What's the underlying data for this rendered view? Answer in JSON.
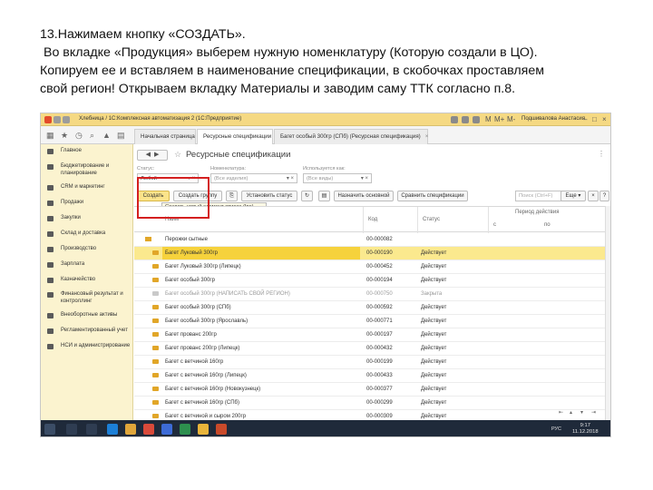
{
  "instructions": {
    "line1": "13.Нажимаем кнопку «СОЗДАТЬ».",
    "line2": "Во вкладке «Продукция» выберем нужную номенклатуру (Которую создали в ЦО).",
    "line3": "Копируем ее и вставляем в наименование спецификации, в скобочках проставляем",
    "line4": "свой регион! Открываем вкладку Материалы и заводим саму ТТК  согласно п.8."
  },
  "window": {
    "title": "Хлебница / 1С:Комплексная автоматизация 2 (1С:Предприятие)",
    "user": "Подшивалова Анастасия"
  },
  "page_tabs": [
    {
      "label": "Начальная страница"
    },
    {
      "label": "Ресурсные спецификации"
    },
    {
      "label": "Багет особый 300гр (СПб) (Ресурсная спецификация)"
    }
  ],
  "sidebar": {
    "items": [
      {
        "label": "Главное",
        "icon": "menu-icon"
      },
      {
        "label": "Бюджетирование и планирование",
        "icon": "chart-icon"
      },
      {
        "label": "CRM и маркетинг",
        "icon": "crm-icon"
      },
      {
        "label": "Продажи",
        "icon": "cart-icon"
      },
      {
        "label": "Закупки",
        "icon": "truck-icon"
      },
      {
        "label": "Склад и доставка",
        "icon": "warehouse-icon"
      },
      {
        "label": "Производство",
        "icon": "factory-icon"
      },
      {
        "label": "Зарплата",
        "icon": "salary-icon"
      },
      {
        "label": "Казначейство",
        "icon": "treasury-icon"
      },
      {
        "label": "Финансовый результат и контроллинг",
        "icon": "finance-icon"
      },
      {
        "label": "Внеоборотные активы",
        "icon": "assets-icon"
      },
      {
        "label": "Регламентированный учет",
        "icon": "ledger-icon"
      },
      {
        "label": "НСИ и администрирование",
        "icon": "settings-icon"
      }
    ]
  },
  "page": {
    "title": "Ресурсные спецификации"
  },
  "filters": {
    "status_label": "Статус:",
    "status_value": "Любой",
    "nomenclature_label": "Номенклатура:",
    "nomenclature_placeholder": "(Все изделия)",
    "used_as_label": "Используется как:",
    "used_as_placeholder": "(Все виды)"
  },
  "toolbar": {
    "create": "Создать",
    "create_group": "Создать группу",
    "set_status": "Установить статус",
    "set_main": "Назначить основной",
    "compare": "Сравнить спецификации",
    "search_placeholder": "Поиск (Ctrl+F)",
    "more": "Еще",
    "help": "?"
  },
  "tooltip": "Создать новый элемент списка (Ins)",
  "table": {
    "headers": {
      "name": "Наим",
      "code": "Код",
      "status": "Статус",
      "period": "Период действия",
      "from": "с",
      "to": "по"
    },
    "group_row": {
      "name": "Перожки сытные",
      "code": "00-000082"
    },
    "rows": [
      {
        "name": "Багет Луковый 300гр",
        "code": "00-000190",
        "status": "Действует"
      },
      {
        "name": "Багет Луковый 300гр (Липецк)",
        "code": "00-000452",
        "status": "Действует"
      },
      {
        "name": "Багет особый 300гр",
        "code": "00-000194",
        "status": "Действует"
      },
      {
        "name": "Багет особый 300гр (НАПИСАТЬ СВОЙ РЕГИОН)",
        "code": "00-000750",
        "status": "Закрыта"
      },
      {
        "name": "Багет особый 300гр (СПб)",
        "code": "00-000592",
        "status": "Действует"
      },
      {
        "name": "Багет особый 300гр (Ярославль)",
        "code": "00-000771",
        "status": "Действует"
      },
      {
        "name": "Багет прованс 200гр",
        "code": "00-000197",
        "status": "Действует"
      },
      {
        "name": "Багет прованс 200гр (Липецк)",
        "code": "00-000432",
        "status": "Действует"
      },
      {
        "name": "Багет с ветчиной 160гр",
        "code": "00-000199",
        "status": "Действует"
      },
      {
        "name": "Багет с ветчиной 160гр (Липецк)",
        "code": "00-000433",
        "status": "Действует"
      },
      {
        "name": "Багет с ветчиной 160гр (Новокузнецк)",
        "code": "00-000377",
        "status": "Действует"
      },
      {
        "name": "Багет с ветчиной 160гр (СПб)",
        "code": "00-000299",
        "status": "Действует"
      },
      {
        "name": "Багет с ветчиной и сыром 200гр",
        "code": "00-000309",
        "status": "Действует"
      }
    ]
  },
  "taskbar": {
    "lang": "РУС",
    "time": "9:17",
    "date": "11.12.2018"
  },
  "colors": {
    "accent": "#f6d23c",
    "highlight_box": "#d42020",
    "sidebar_bg": "#fbf3cf"
  }
}
